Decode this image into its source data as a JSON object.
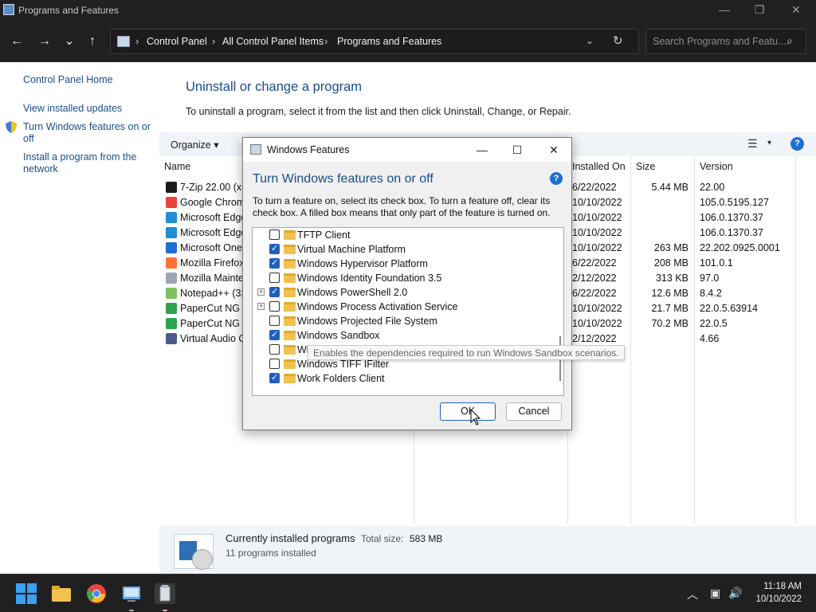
{
  "window": {
    "title": "Programs and Features",
    "minimize_glyph": "—",
    "maximize_glyph": "❐",
    "close_glyph": "✕"
  },
  "nav": {
    "back_glyph": "←",
    "forward_glyph": "→",
    "recent_glyph": "⌄",
    "up_glyph": "↑",
    "breadcrumbs": [
      "Control Panel",
      "All Control Panel Items",
      "Programs and Features"
    ],
    "sep_glyph": "›",
    "dropdown_glyph": "⌄",
    "refresh_glyph": "↻",
    "search_placeholder": "Search Programs and Featu...",
    "search_glyph": "⌕"
  },
  "left_pane": {
    "home": "Control Panel Home",
    "view_updates": "View installed updates",
    "features_line1": "Turn Windows features on or",
    "features_line2": "off",
    "install_line1": "Install a program from the",
    "install_line2": "network"
  },
  "main": {
    "heading": "Uninstall or change a program",
    "description": "To uninstall a program, select it from the list and then click Uninstall, Change, or Repair.",
    "organize": "Organize ▾",
    "view_glyph": "☰",
    "view_chev": "▾",
    "help_glyph": "?",
    "columns": {
      "name": "Name",
      "installed": "Installed On",
      "size": "Size",
      "version": "Version"
    },
    "programs": [
      {
        "name": "7-Zip 22.00 (x64)",
        "date": "6/22/2022",
        "size": "5.44 MB",
        "version": "22.00",
        "color": "#1b1b1b"
      },
      {
        "name": "Google Chrome",
        "date": "10/10/2022",
        "size": "",
        "version": "105.0.5195.127",
        "color": "#e8453c"
      },
      {
        "name": "Microsoft Edge",
        "date": "10/10/2022",
        "size": "",
        "version": "106.0.1370.37",
        "color": "#1f8fd6"
      },
      {
        "name": "Microsoft Edge WebView2",
        "date": "10/10/2022",
        "size": "",
        "version": "106.0.1370.37",
        "color": "#1f8fd6"
      },
      {
        "name": "Microsoft OneDrive",
        "date": "10/10/2022",
        "size": "263 MB",
        "version": "22.202.0925.0001",
        "color": "#1f6fd1"
      },
      {
        "name": "Mozilla Firefox",
        "date": "6/22/2022",
        "size": "208 MB",
        "version": "101.0.1",
        "color": "#ff7139"
      },
      {
        "name": "Mozilla Maintenance Service",
        "date": "2/12/2022",
        "size": "313 KB",
        "version": "97.0",
        "color": "#9aa7b5"
      },
      {
        "name": "Notepad++ (32-bit x86)",
        "date": "6/22/2022",
        "size": "12.6 MB",
        "version": "8.4.2",
        "color": "#7fbf5a"
      },
      {
        "name": "PaperCut NG",
        "date": "10/10/2022",
        "size": "21.7 MB",
        "version": "22.0.5.63914",
        "color": "#2ea44f"
      },
      {
        "name": "PaperCut NG Client",
        "date": "10/10/2022",
        "size": "70.2 MB",
        "version": "22.0.5",
        "color": "#2ea44f"
      },
      {
        "name": "Virtual Audio Cable",
        "date": "2/12/2022",
        "size": "",
        "version": "4.66",
        "color": "#4a5a8a"
      }
    ]
  },
  "footer": {
    "label": "Currently installed programs",
    "total_label": "Total size:",
    "total_value": "583 MB",
    "count": "11 programs installed"
  },
  "dialog": {
    "title": "Windows Features",
    "heading": "Turn Windows features on or off",
    "help_glyph": "?",
    "description": "To turn a feature on, select its check box. To turn a feature off, clear its check box. A filled box means that only part of the feature is turned on.",
    "features": [
      {
        "label": "TFTP Client",
        "checked": false,
        "expandable": false
      },
      {
        "label": "Virtual Machine Platform",
        "checked": true,
        "expandable": false
      },
      {
        "label": "Windows Hypervisor Platform",
        "checked": true,
        "expandable": false
      },
      {
        "label": "Windows Identity Foundation 3.5",
        "checked": false,
        "expandable": false
      },
      {
        "label": "Windows PowerShell 2.0",
        "checked": true,
        "expandable": true
      },
      {
        "label": "Windows Process Activation Service",
        "checked": false,
        "expandable": true
      },
      {
        "label": "Windows Projected File System",
        "checked": false,
        "expandable": false
      },
      {
        "label": "Windows Sandbox",
        "checked": true,
        "expandable": false
      },
      {
        "label": "Windows Subsystem for Linux",
        "checked": false,
        "expandable": false
      },
      {
        "label": "Windows TIFF IFilter",
        "checked": false,
        "expandable": false
      },
      {
        "label": "Work Folders Client",
        "checked": true,
        "expandable": false
      }
    ],
    "tooltip": "Enables the dependencies required to run Windows Sandbox scenarios.",
    "ok": "OK",
    "cancel": "Cancel"
  },
  "taskbar": {
    "time": "11:18 AM",
    "date": "10/10/2022",
    "chevron_glyph": "︿",
    "network_glyph": "▣",
    "volume_glyph": "🔊"
  }
}
